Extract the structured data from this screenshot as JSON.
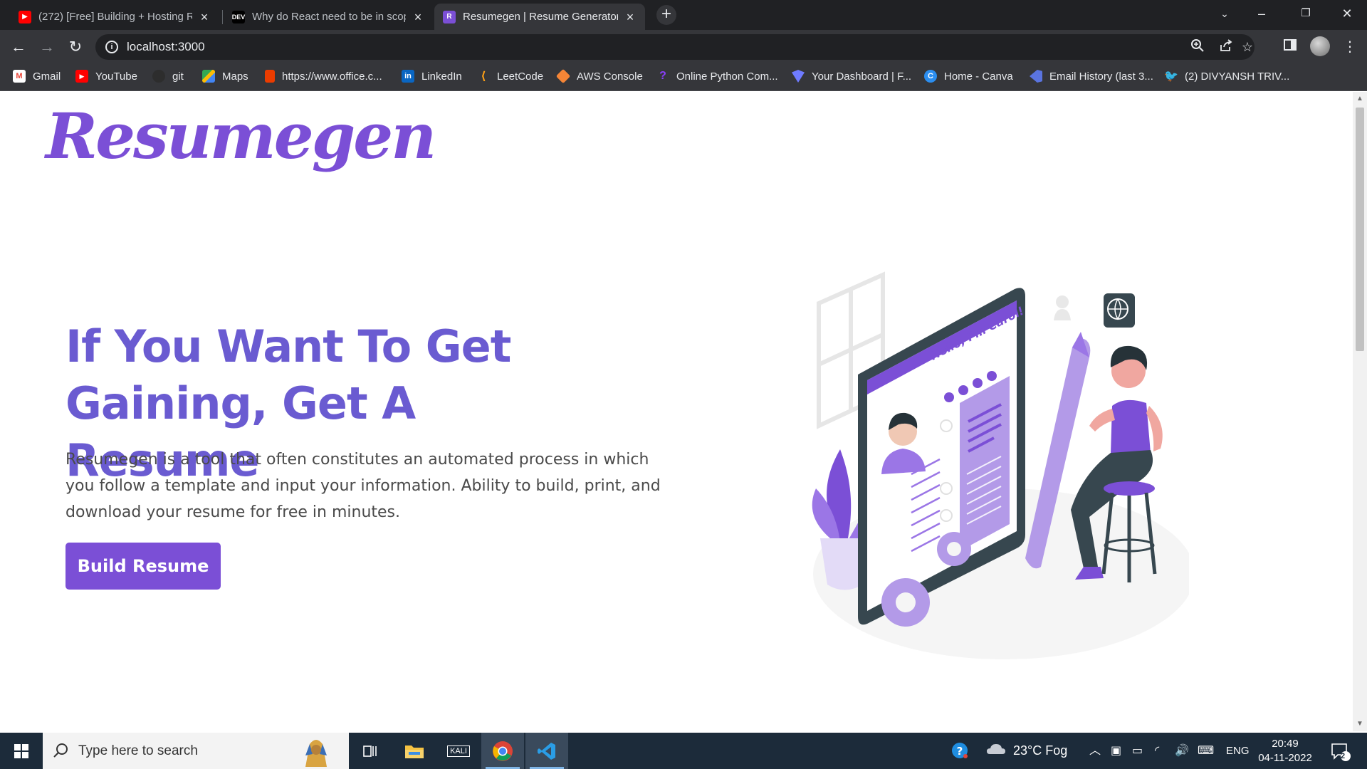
{
  "browser": {
    "tabs": [
      {
        "title": "(272) [Free] Building + Hosting R",
        "favicon": "youtube-icon",
        "active": false
      },
      {
        "title": "Why do React need to be in scop",
        "favicon": "dev-icon",
        "favicon_text": "DEV",
        "active": false
      },
      {
        "title": "Resumegen | Resume Generator",
        "favicon": "resumegen-icon",
        "favicon_text": "R",
        "active": true
      }
    ],
    "new_tab": "+",
    "url": "localhost:3000",
    "bookmarks": [
      {
        "label": "Gmail",
        "icon": "gmail-icon",
        "glyph": "M",
        "color": "#ea4335"
      },
      {
        "label": "YouTube",
        "icon": "youtube-icon",
        "glyph": "▶",
        "color": "#ff0000"
      },
      {
        "label": "git",
        "icon": "github-icon",
        "glyph": "",
        "color": "#2d2d2d"
      },
      {
        "label": "Maps",
        "icon": "maps-icon",
        "glyph": "",
        "color": "#34a853"
      },
      {
        "label": "https://www.office.c...",
        "icon": "office-icon",
        "glyph": "",
        "color": "#eb3c00"
      },
      {
        "label": "LinkedIn",
        "icon": "linkedin-icon",
        "glyph": "in",
        "color": "#0a66c2"
      },
      {
        "label": "LeetCode",
        "icon": "leetcode-icon",
        "glyph": "",
        "color": "#2d2d2d"
      },
      {
        "label": "AWS Console",
        "icon": "aws-icon",
        "glyph": "",
        "color": "#f58536"
      },
      {
        "label": "Online Python Com...",
        "icon": "python-icon",
        "glyph": "",
        "color": "#6b2ee8"
      },
      {
        "label": "Your Dashboard | F...",
        "icon": "dashboard-icon",
        "glyph": "",
        "color": "#6f7bff"
      },
      {
        "label": "Home - Canva",
        "icon": "canva-icon",
        "glyph": "C",
        "color": "#2b8ef0"
      },
      {
        "label": "Email History (last 3...",
        "icon": "email-history-icon",
        "glyph": "",
        "color": "#5a74e0"
      },
      {
        "label": "(2) DIVYANSH TRIV...",
        "icon": "twitter-icon",
        "glyph": "",
        "color": "#1d9bf0"
      }
    ]
  },
  "page": {
    "logo": "Resumegen",
    "headline_line1": "If You Want To Get",
    "headline_line2": "Gaining, Get A Resume",
    "description": "Resumegen is a tool that often constitutes an automated process in which you follow a template and input your information. Ability to build, print, and download your resume for free in minutes.",
    "cta_label": "Build Resume",
    "illustration_text": "Hello, I'm Carol!",
    "accent_color": "#7b4fd6"
  },
  "taskbar": {
    "search_placeholder": "Type here to search",
    "weather": "23°C  Fog",
    "language": "ENG",
    "time": "20:49",
    "date": "04-11-2022",
    "notification_count": "2"
  }
}
